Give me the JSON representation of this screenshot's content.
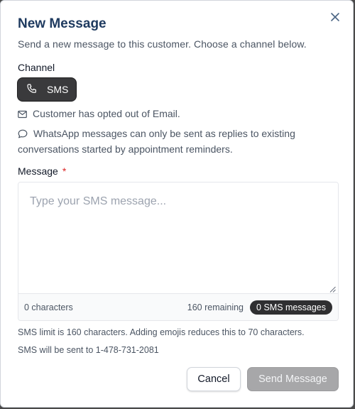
{
  "dialog": {
    "title": "New Message",
    "subtitle": "Send a new message to this customer. Choose a channel below."
  },
  "channel": {
    "label": "Channel",
    "selected": "SMS"
  },
  "notes": {
    "email_opt_out": "Customer has opted out of Email.",
    "whatsapp": "WhatsApp messages can only be sent as replies to existing conversations started by appointment reminders."
  },
  "message": {
    "label": "Message",
    "required_mark": "*",
    "placeholder": "Type your SMS message...",
    "value": "",
    "characters": "0 characters",
    "remaining": "160 remaining",
    "sms_count": "0 SMS messages"
  },
  "hints": {
    "limit": "SMS limit is 160 characters. Adding emojis reduces this to 70 characters.",
    "recipient": "SMS will be sent to 1-478-731-2081"
  },
  "buttons": {
    "cancel": "Cancel",
    "send": "Send Message"
  },
  "icons": {
    "close": "close-icon",
    "channel": "phone-icon",
    "email_note": "mail-icon",
    "whatsapp_note": "chat-bubble-icon"
  },
  "colors": {
    "title": "#1e3a5f",
    "chip_bg": "#3a3a3c",
    "required": "#dc2626",
    "send_disabled": "#a7a7a9"
  }
}
